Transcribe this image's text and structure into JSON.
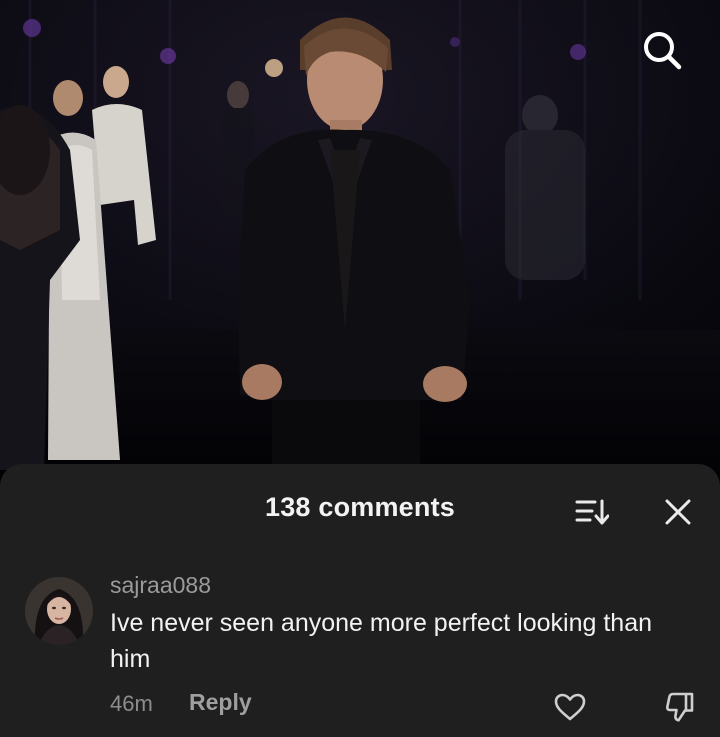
{
  "video": {
    "search_icon": "search-icon"
  },
  "comments_sheet": {
    "title": "138 comments",
    "sort_icon": "sort-icon",
    "close_icon": "close-icon",
    "comments": [
      {
        "username": "sajraa088",
        "text": "Ive never seen anyone more perfect looking than him",
        "timestamp": "46m",
        "reply_label": "Reply",
        "like_icon": "heart-icon",
        "dislike_icon": "dislike-icon"
      }
    ]
  },
  "colors": {
    "sheet_background": "#1f1f1f",
    "primary_text": "#f2f2f2",
    "secondary_text": "#9b9b9b"
  }
}
